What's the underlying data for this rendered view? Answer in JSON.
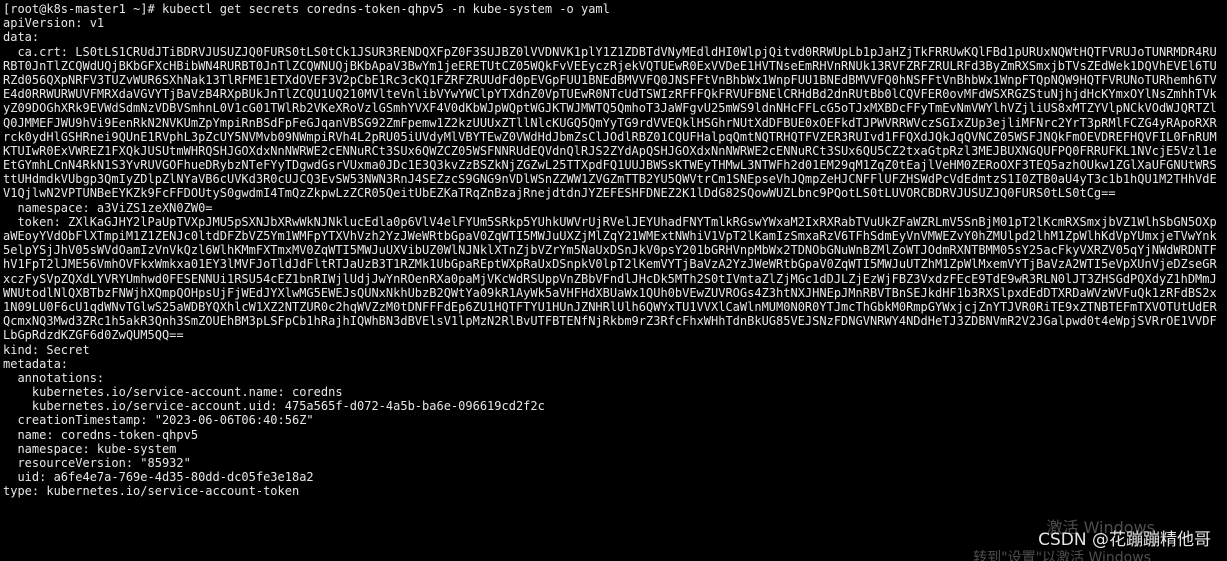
{
  "terminal": {
    "prompt": "[root@k8s-master1 ~]# ",
    "command": "kubectl get secrets coredns-token-qhpv5 -n kube-system -o yaml",
    "lines": [
      "apiVersion: v1",
      "data:"
    ],
    "ca_crt": "  ca.crt: LS0tLS1CRUdJTiBDRVJUSUZJQ0FURS0tLS0tCk1JSUR3RENDQXFpZ0F3SUJBZ0lVVDNVK1plY1Z1ZDBTdVNyMEdldHI0WlpjQitvd0RRWUpLb1pJaHZjTkFRRUwKQlFBd1pURUxNQWtHQTFVRUJoTUNRMDR4RURBT0JnTlZCQWdUQjBKbGFXcHBibWN4RURBT0JnTlZCQWNUQjBKbApaV3BwYm1jeERETUtCZ05WQkFvVEEyczRjekVQTUEwR0ExVVDeE1HVTNseEmRHVnRNUk13RVFZRFZRULRFd3ByZmRXSmxjbTVsZEdWek1DQVhEVEl6TURZd056QXpNRFV3TUZvWUR6SXhNak13TlRFME1ETXdOVEF3V2pCbE1Rc3cKQ1FZRFZRUUdFd0pEVGpFUU1BNEdBMVVFQ0JNSFFtVnBhbWx1WnpFUU1BNEdBMVVFQ0hNSFFtVnBhbWx1WnpFTQpNQW9HQTFVRUNoTURhemh6TVE4d0RRWURWUVFMRXdaVGVYTjBaVzB4RXpBUkJnTlZCQU1UQ210MVlteVnlibVYwYWClpYTXdnZ0VpTUEwR0NTcUdTSWIzRFFFQkFRVUFBNElCRHdBd2dnRUtBb0lCQVFER0ovMFdWSXRGZStuNjhjdHcKYmxOYlNsZmhhTVkyZ09DOGhXRk9EVWdSdmNzVDBVSmhnL0V1cG01TWlRb2VKeXRoVzlGSmhYVXF4V0dKbWJpWQptWGJKTWJMWTQ5QmhoT3JaWFgvU25mWS9ldnNHcFFLcG5oTJxMXBDcFFyTmEvNmVWYlhVZjliUS8xMTZYVlpNCkVOdWJQRTZlQ0JMMEFJWU9hVi9EenRkN2NVKUmZpYmpiRnBSdFpFeGJqanVBSG92ZmFpemw1Z2kzUUUxZTllNlcKUGQ5QmYyTG9rdVVEQklHSGhrNUtXdDFBUE0xOEFkdTJPWVRRWVczSGIxZUp3ejliMFNrc2YrT3pRMlFCZG4yRApoRXRrck0ydHlGSHRnei9QUnE1RVphL3pZcUY5NVMvb09NWmpiRVh4L2pRU05iUVdyMlVBYTEwZ0VWdHdJbmZsClJOdlRBZ01CQUFHalpqQmtNQTRHQTFVZER3RUIvd1FFQXdJQkJqQVNCZ05WSFJNQkFmOEVDREFHQVFIL0FnRUMKTUIwR0ExVWREZ1FXQkJUSUtmWHRQSHJGOXdxNnNWRWE2cENNuRCt3SUx6QWZCZ05WSFNNRUdEQVdnQlRJS2ZYdApQSHJGOXdxNnNWRWE2cENNuRCt3SUx6QU5CZ2txaGtpRzl3MEJBUXNGQUFPQ0FRRUFKL1NVcjE5Vzl1eEtGYmhLCnN4RkN1S3YvRUVGOFhueDRybzNTeFYyTDgwdGsrVUxma0JDc1E3Q3kvZzBSZkNjZGZwL25TTXpdFQ1UUJBWSsKTWEyTHMwL3NTWFh2d01EM29qM1ZqZ0tEajlVeHM0ZERoOXF3TEQ5azhOUkw1ZGlXaUFGNUtWRSttUHdmdkVUbgp3QmIyZDlpZlNYaVB6cUVKd3R0cUJCQ3EvSW53NWN3RnJ4SEZzcS9GNG9nVDlWSnZZWW1ZVGZmTTB2YU5QWVtrCm1SNEpseVhJQmpZeHJCNFFlUFZHSWdPcVdEdmtzS1I0ZTB0aU4yT3c1b1hQU1M2THhVdEV1QjlwN2VPTUNBeEYKZk9FcFFDOUtyS0gwdmI4TmQzZkpwLzZCR05QeitUbEZKaTRqZnBzajRnejdtdnJYZEFESHFDNEZ2K1lDdG82SQowWUZLbnc9PQotLS0tLUVORCBDRVJUSUZJQ0FURS0tLS0tCg==",
    "namespace_line": "  namespace: a3ViZS1zeXN0ZW0=",
    "token": "  token: ZXlKaGJHY2lPaUpTVXpJMU5pSXNJbXRwWkNJNklucEdla0p6VlV4elFYUm5SRkp5YUhkUWVrUjRVelJEYUhadFNYTmlkRGswYWxaM2IxRXRabTVuUkZFaWZRLmV5SnBjM01pT2lKcmRXSmxjbVZ1WlhSbGN5OXpaWEoyYVdObFlXTmpiM1Z1ZENJc0ltdDFZbVZ5Ym1WMFpYTXVhVzh2YzJWeWRtbGpaV0ZqWTI5MWJuUXZjMlZqY21WMExtNWhiV1VpT2lKamIzSmxaRzV6TFhSdmEyVnVMWEZvY0hZMUlpd2lhM1ZpWlhKdVpYUmxjeTVwYnk5elpYSjJhV05sWVdOamIzVnVkQzl6WlhKMmFXTmxMV0ZqWTI5MWJuUXVibUZ0WlNJNklXTnZjbVZrYm5NaUxDSnJkV0psY201bGRHVnpMbWx2TDNObGNuWnBZMlZoWTJOdmRXNTBMM05sY25acFkyVXRZV05qYjNWdWRDNTFhV1FpT2lJME56VmhOVFkxWmkxa01EY3lMVFJoTldJdFltRTJaUzB3T1RZMk1UbGpaREptWXpRaUxDSnpkV0lpT2lKemVYTjBaVzA2YzJWeWRtbGpaV0ZqWTI5MWJuUTZhM1ZpWlMxemVYTjBaVzA2WTI5eVpXUnVjeDZseGRxczFySVpZQXdLYVRYUmhwd0FESENNUi1RSU54cEZ1bnRIWjlUdjJwYnROenRXa0paMjVKcWdRSUppVnZBbVFndlJHcDk5MTh2S0tIVmtaZlZjMGc1dDJLZjEzWjFBZ3VxdzFEcE9TdE9wR3RLN0lJT3ZHSGdPQXdyZ1hDMmJWNUtodlNlQXBTbzFNWjhXQmpQOHpsUjFjWEdJYXlwMG5EWEJsQUNxNkhUbzB2QWtYa09kR1AyWk5aVHFHdXBUaWx1QUh0bVEwZUVROGs4Z3htNXJHNEpJMnRBVTBnSEJkdHF1b3RXSlpxdEdDTXRDaWVzWVFuQk1zRFdBS2x1N09LU0F6cU1qdWNvTGlwS25aWDBYQXhlcW1XZ2NTZUR0c2hqWVZzM0tDNFFFdEp6ZU1HQTFTYU1HUnJZNHRlUlh6QWYxTU1VVXlCaWlnMUM0N0R0YTJmcThGbkM0RmpGYWxjcjZnYTJVR0RiTE9xZTNBTEFmTXVOTUtUdERQcmxNQ3Mwd3ZRc1h5akR3Qnh3SmZOUEhBM3pLSFpCb1hRajhIQWhBN3dBVElsV1lpMzN2RlBvUTFBTENfNjRkbm9rZ3RfcFhxWHhTdnBkUG85VEJSNzFDNGVNRWY4NDdHeTJ3ZDBNVmR2V2JGalpwd0t4eWpjSVRrOE1VVDFLbGpRdzdKZGF6d0ZwQUM5QQ==",
    "tail_lines": [
      "kind: Secret",
      "metadata:",
      "  annotations:",
      "    kubernetes.io/service-account.name: coredns",
      "    kubernetes.io/service-account.uid: 475a565f-d072-4a5b-ba6e-096619cd2f2c",
      "  creationTimestamp: \"2023-06-06T06:40:56Z\"",
      "  name: coredns-token-qhpv5",
      "  namespace: kube-system",
      "  resourceVersion: \"85932\"",
      "  uid: a6fe4e7a-769e-4d35-80dd-dc05fe3e18a2",
      "type: kubernetes.io/service-account-token"
    ]
  },
  "overlay": {
    "activate_windows": "激活 Windows",
    "activate_windows_sub": "转到\"设置\"以激活 Windows",
    "csdn_watermark": "CSDN @花蹦蹦精他哥"
  }
}
